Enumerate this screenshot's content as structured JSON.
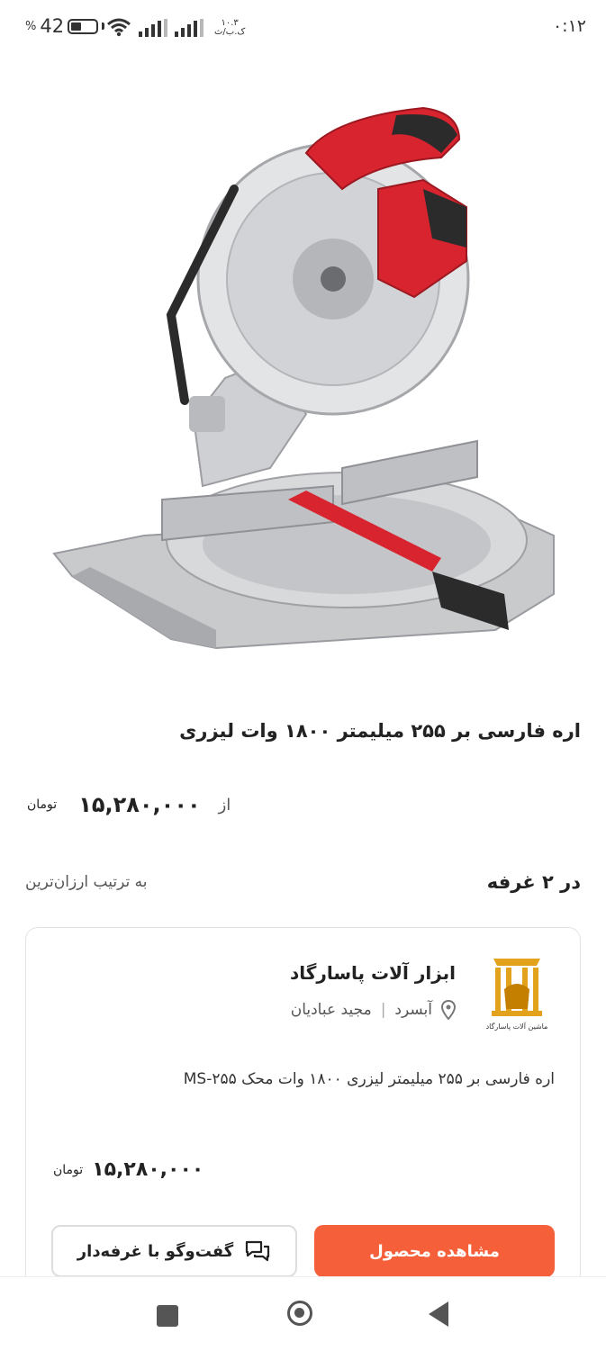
{
  "status_bar": {
    "time": "۰:۱۲",
    "battery": "42",
    "battery_percent_sign": "%",
    "battery_level": 0.42,
    "speed_value": "۱۰.۳",
    "speed_unit": "ک.ب/ث"
  },
  "product": {
    "image_icon": "miter-saw-image",
    "title": "اره فارسی بر ۲۵۵ میلیمتر ۱۸۰۰ وات لیزری",
    "from_label": "از",
    "price": "۱۵,۲۸۰,۰۰۰",
    "currency": "تومان"
  },
  "shops": {
    "count_label": "در ۲ غرفه",
    "sort_label": "به ترتیب ارزان‌ترین"
  },
  "offer": {
    "shop_name": "ابزار آلات پاسارگاد",
    "city": "آبسرد",
    "owner": "مجید عبادیان",
    "meta_separator": "|",
    "logo_text": "ماشین آلات پاسارگاد",
    "title": "اره فارسی بر ۲۵۵ میلیمتر لیزری ۱۸۰۰ وات محک MS-۲۵۵",
    "price": "۱۵,۲۸۰,۰۰۰",
    "currency": "تومان",
    "view_button": "مشاهده محصول",
    "chat_button": "گفت‌وگو با غرفه‌دار"
  },
  "colors": {
    "accent": "#f5603a",
    "saw_red": "#d7242f",
    "logo_gold": "#e2a21b"
  },
  "navbar": {
    "icons": [
      "recents-square-icon",
      "home-circle-icon",
      "back-triangle-icon"
    ]
  }
}
